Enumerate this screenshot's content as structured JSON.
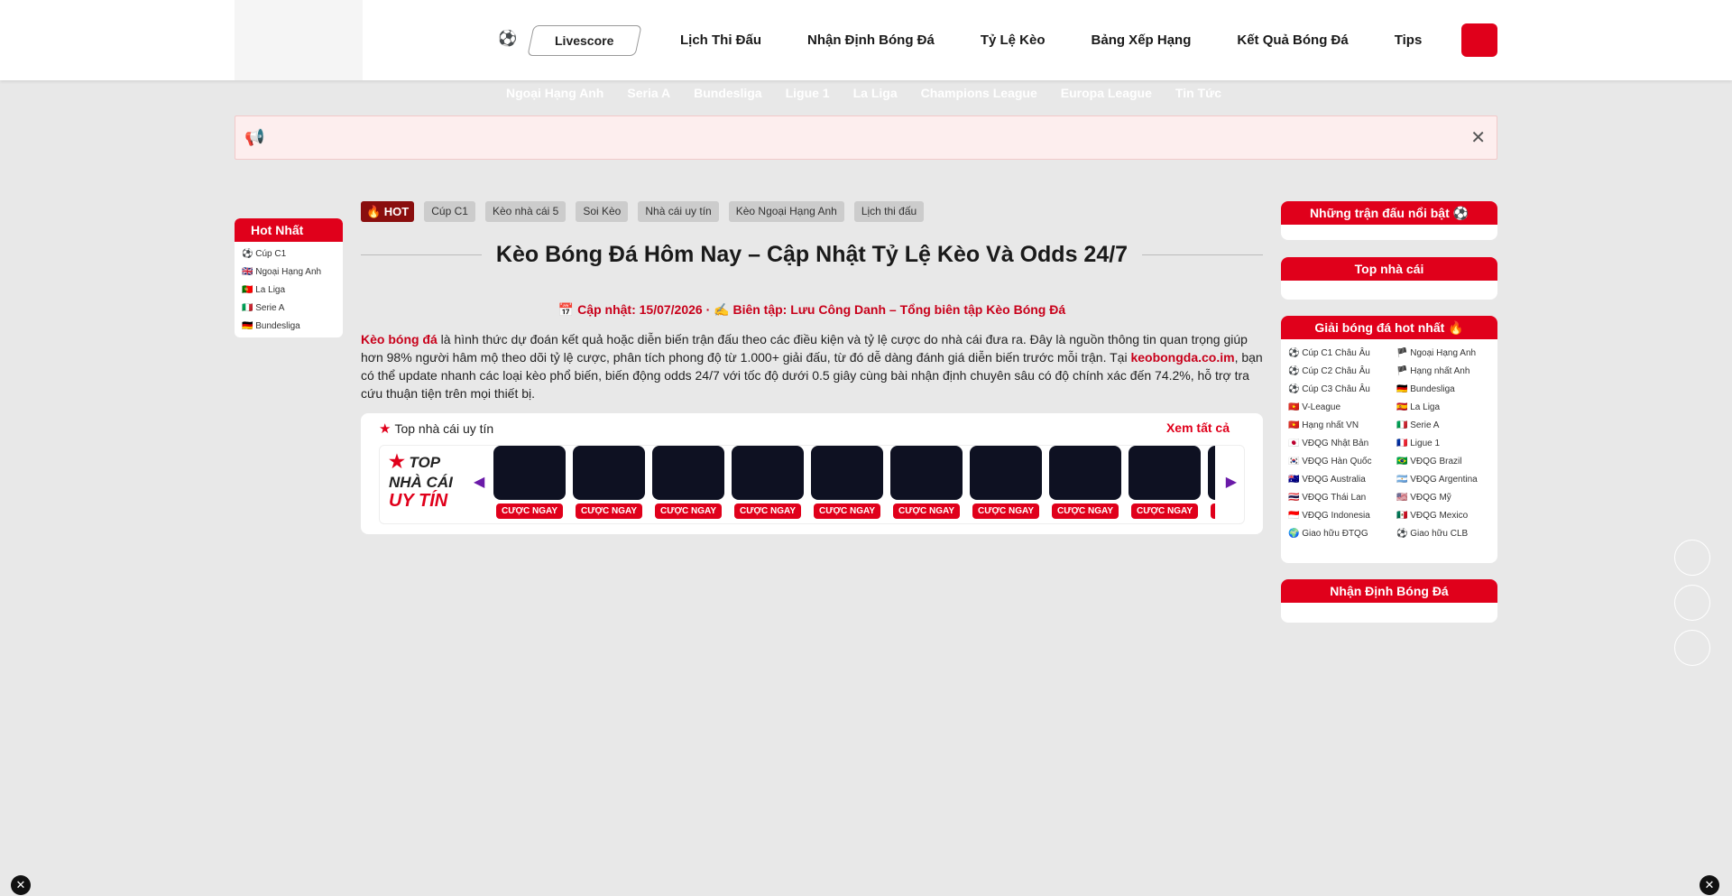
{
  "header": {
    "livescore": "Livescore",
    "nav": [
      "Lịch Thi Đấu",
      "Nhận Định Bóng Đá",
      "Tỷ Lệ Kèo",
      "Bảng Xếp Hạng",
      "Kết Quả Bóng Đá",
      "Tips"
    ]
  },
  "subnav": [
    "Ngoại Hạng Anh",
    "Seria A",
    "Bundesliga",
    "Ligue 1",
    "La Liga",
    "Champions League",
    "Europa League",
    "Tin Tức"
  ],
  "left_sidebar": {
    "title": "Hot Nhất",
    "items": [
      "⚽ Cúp C1",
      "🇬🇧 Ngoại Hạng Anh",
      "🇵🇹 La Liga",
      "🇮🇹 Serie A",
      "🇩🇪 Bundesliga"
    ]
  },
  "tags": [
    "🔥 HOT",
    "Cúp C1",
    "Kèo nhà cái 5",
    "Soi Kèo",
    "Nhà cái uy tín",
    "Kèo Ngoại Hạng Anh",
    "Lịch thi đấu"
  ],
  "article": {
    "title": "Kèo Bóng Đá Hôm Nay – Cập Nhật Tỷ Lệ Kèo Và Odds 24/7",
    "meta": "📅 Cập nhật: 15/07/2026 · ✍️ Biên tập: Lưu Công Danh – Tổng biên tập Kèo Bóng Đá",
    "intro_link1": "Kèo bóng đá",
    "intro_text1": " là hình thức dự đoán kết quả hoặc diễn biến trận đấu theo các điều kiện và tỷ lệ cược do nhà cái đưa ra. Đây là nguồn thông tin quan trọng giúp hơn 98% người hâm mộ theo dõi tỷ lệ cược, phân tích phong độ từ 1.000+ giải đấu, từ đó dễ dàng đánh giá diễn biến trước mỗi trận. Tại ",
    "intro_link2": "keobongda.co.im",
    "intro_text2": ", bạn có thể update nhanh các loại kèo phổ biến, biến động odds 24/7 với tốc độ dưới 0.5 giây cùng bài nhận định chuyên sâu có độ chính xác đến 74.2%, hỗ trợ tra cứu thuận tiện trên mọi thiết bị."
  },
  "top_box": {
    "title": "Top nhà cái uy tín",
    "see_all": "Xem tất cả",
    "badge_line1": "TOP",
    "badge_line2": "NHÀ CÁI",
    "badge_line3": "UY TÍN",
    "cta": "CƯỢC NGAY",
    "card_count": 10
  },
  "right_sidebar": {
    "featured_title": "Những trận đấu nổi bật ⚽",
    "top_bookmakers_title": "Top nhà cái",
    "leagues_title": "Giải bóng đá hot nhất 🔥",
    "leagues": [
      "⚽ Cúp C1 Châu Âu",
      "🏴 Ngoại Hạng Anh",
      "⚽ Cúp C2 Châu Âu",
      "🏴 Hạng nhất Anh",
      "⚽ Cúp C3 Châu Âu",
      "🇩🇪 Bundesliga",
      "🇻🇳 V-League",
      "🇪🇸 La Liga",
      "🇻🇳 Hạng nhất VN",
      "🇮🇹 Serie A",
      "🇯🇵 VĐQG Nhật Bản",
      "🇫🇷 Ligue 1",
      "🇰🇷 VĐQG Hàn Quốc",
      "🇧🇷 VĐQG Brazil",
      "🇦🇺 VĐQG Australia",
      "🇦🇷 VĐQG Argentina",
      "🇹🇭 VĐQG Thái Lan",
      "🇺🇸 VĐQG Mỹ",
      "🇮🇩 VĐQG Indonesia",
      "🇲🇽 VĐQG Mexico",
      "🌍 Giao hữu ĐTQG",
      "⚽ Giao hữu CLB"
    ],
    "predictions_title": "Nhận Định Bóng Đá"
  },
  "colors": {
    "brand_red": "#e0001b",
    "dark_card": "#0e1122",
    "hot_tag": "#8a0e0e"
  }
}
